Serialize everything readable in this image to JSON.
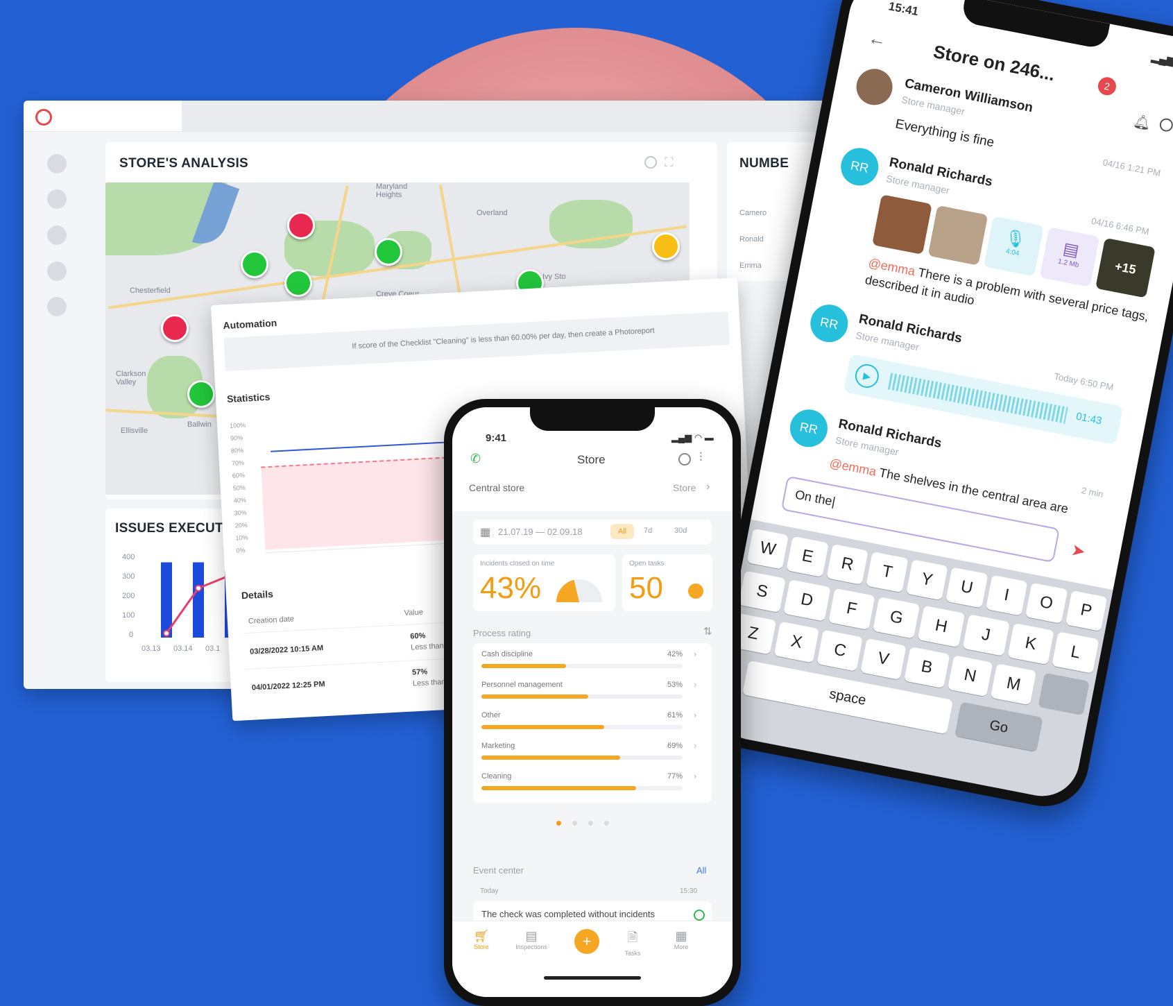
{
  "dashboard": {
    "analysis_title": "STORE'S ANALYSIS",
    "number_title": "NUMBE",
    "issues_title": "ISSUES EXECUTI",
    "number_rows": [
      "Camero",
      "Ronald",
      "Emma"
    ],
    "map_labels": [
      "Overland",
      "Chesterfield",
      "Creve Coeur",
      "Clarkson Valley",
      "Ellisville",
      "Ballwin",
      "Maryland Heights",
      "Ivy Sto"
    ],
    "issues_chart": {
      "yticks": [
        "400",
        "300",
        "200",
        "100",
        "0"
      ],
      "xticks": [
        "03.13",
        "03.14",
        "03.1"
      ]
    }
  },
  "chart_data": {
    "type": "bar",
    "categories": [
      "03.13",
      "03.14",
      "03.1"
    ],
    "series": [
      {
        "values": [
          350,
          350,
          350
        ]
      },
      {
        "values": [
          20,
          230,
          290
        ]
      }
    ],
    "ylim": [
      0,
      400
    ]
  },
  "automation": {
    "title": "Automation",
    "rule_text": "If score of the Checklist \"Cleaning\" is less than 60.00% per day, then create a Photoreport",
    "statistics_title": "Statistics",
    "yticks": [
      "100%",
      "90%",
      "80%",
      "70%",
      "60%",
      "50%",
      "40%",
      "30%",
      "20%",
      "10%",
      "0%"
    ],
    "details_title": "Details",
    "col_creation": "Creation date",
    "col_value": "Value",
    "rows": [
      {
        "date": "03/28/2022 10:15 AM",
        "value": "60%",
        "note": "Less than"
      },
      {
        "date": "04/01/2022 12:25 PM",
        "value": "57%",
        "note": "Less than"
      }
    ]
  },
  "store_phone": {
    "time": "9:41",
    "title": "Store",
    "location": "Central store",
    "location_link": "Store",
    "date_range": "21.07.19 — 02.09.18",
    "chips": [
      "All",
      "7d",
      "30d"
    ],
    "incidents_label": "Incidents closed on time",
    "incidents_value": "43%",
    "open_tasks_label": "Open tasks",
    "open_tasks_value": "50",
    "process_title": "Process rating",
    "ratings": [
      {
        "name": "Cash discipline",
        "pct": "42%",
        "value": 42
      },
      {
        "name": "Personnel management",
        "pct": "53%",
        "value": 53
      },
      {
        "name": "Other",
        "pct": "61%",
        "value": 61
      },
      {
        "name": "Marketing",
        "pct": "69%",
        "value": 69
      },
      {
        "name": "Cleaning",
        "pct": "77%",
        "value": 77
      }
    ],
    "event_center": "Event center",
    "event_all": "All",
    "event_day": "Today",
    "event_time": "15:30",
    "event_text": "The check was completed without incidents",
    "nav": [
      "Store",
      "Inspections",
      "Tasks",
      "More"
    ],
    "accent": "#f39c12"
  },
  "chat_phone": {
    "time": "15:41",
    "title": "Store on 246...",
    "badge": "2",
    "messages": [
      {
        "name": "Cameron Williamson",
        "role": "Store manager",
        "time": "04/16 1:21 PM",
        "text": "Everything is fine"
      },
      {
        "name": "Ronald Richards",
        "role": "Store manager",
        "time": "04/16 6:46 PM",
        "mention": "@emma",
        "text": "There is a problem with several price tags, described it in audio"
      },
      {
        "name": "Ronald Richards",
        "role": "Store manager",
        "time": "Today 6:50 PM",
        "audio": "01:43"
      },
      {
        "name": "Ronald Richards",
        "role": "Store manager",
        "time": "2 min",
        "mention": "@emma",
        "text": "The shelves in the central area are"
      }
    ],
    "initials": "RR",
    "audio_len": "4:04",
    "doc_size": "1.2 Mb",
    "more_count": "+15",
    "input_value": "On the|",
    "keys_row1": [
      "W",
      "E",
      "R",
      "T",
      "Y",
      "U",
      "I",
      "O",
      "P"
    ],
    "keys_row2": [
      "S",
      "D",
      "F",
      "G",
      "H",
      "J",
      "K",
      "L"
    ],
    "keys_row3": [
      "Z",
      "X",
      "C",
      "V",
      "B",
      "N",
      "M"
    ],
    "space": "space",
    "go": "Go"
  }
}
